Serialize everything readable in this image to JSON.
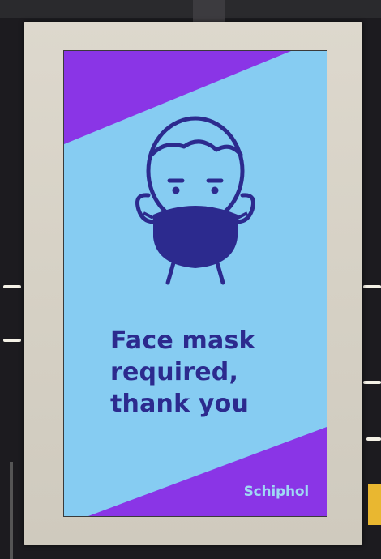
{
  "sign": {
    "headline_lines": [
      "Face mask",
      "required,",
      "thank you"
    ],
    "brand": "Schiphol"
  },
  "icons": [
    "face-mask-person-icon"
  ],
  "colors": {
    "screen_background": "#86ccf2",
    "accent_purple": "#8a35e6",
    "text_navy": "#2c2a8e",
    "brand_text": "#9fd8f4",
    "frame": "#d6d1c5"
  }
}
